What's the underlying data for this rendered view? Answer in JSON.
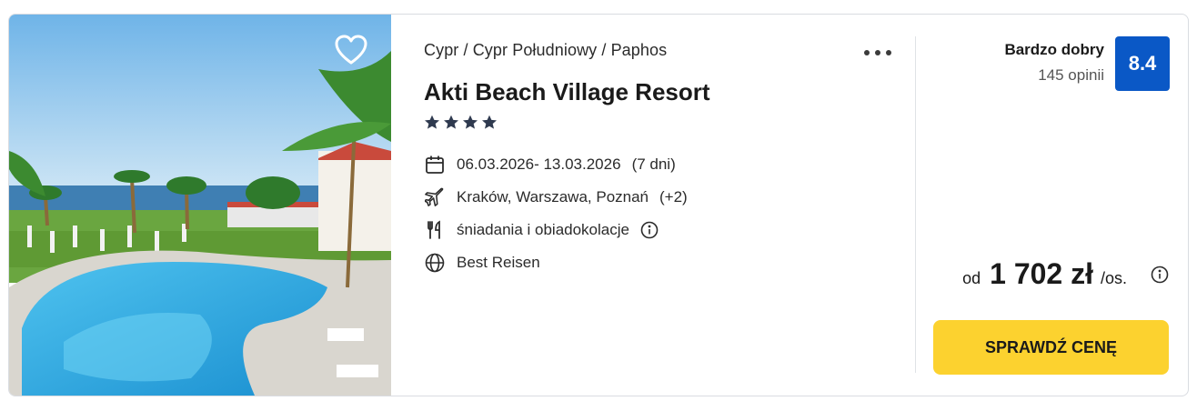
{
  "offer": {
    "breadcrumb": "Cypr / Cypr Południowy / Paphos",
    "title": "Akti Beach Village Resort",
    "stars": 4,
    "dates": "06.03.2026- 13.03.2026",
    "duration": "(7 dni)",
    "departure": "Kraków, Warszawa, Poznań",
    "departure_more": "(+2)",
    "board": "śniadania i obiadokolacje",
    "operator": "Best Reisen"
  },
  "rating": {
    "label": "Bardzo dobry",
    "reviews": "145 opinii",
    "score": "8.4"
  },
  "price": {
    "prefix": "od",
    "amount": "1 702 zł",
    "suffix": "/os."
  },
  "cta_label": "SPRAWDŹ CENĘ",
  "icons": [
    "heart-icon",
    "more-icon",
    "star-icon",
    "calendar-icon",
    "plane-icon",
    "cutlery-icon",
    "info-icon",
    "globe-icon"
  ],
  "colors": {
    "score_bg": "#0a58c6",
    "cta_bg": "#fcd22f",
    "star": "#2f3a4f"
  }
}
